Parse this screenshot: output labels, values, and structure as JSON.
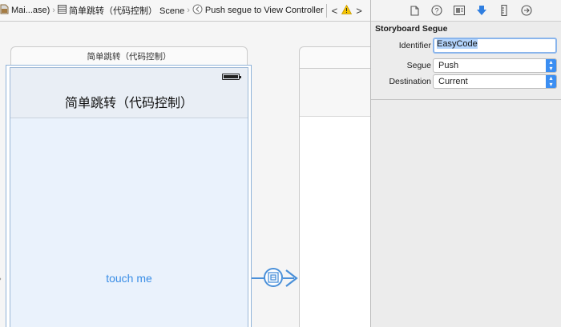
{
  "jumpbar": {
    "item1": "Mai...ase)",
    "item2": "简单跳转（代码控制） Scene",
    "item3": "Push segue to View Controller",
    "back_glyph": "<",
    "forward_glyph": ">"
  },
  "scene1": {
    "title": "简单跳转（代码控制）",
    "nav_title": "简单跳转（代码控制）",
    "button_label": "touch me"
  },
  "inspector": {
    "tabs": [
      "file-icon",
      "help-icon",
      "identity-icon",
      "attributes-icon",
      "size-icon",
      "connections-icon"
    ],
    "section_title": "Storyboard Segue",
    "identifier_label": "Identifier",
    "identifier_value": "EasyCode",
    "segue_label": "Segue",
    "segue_value": "Push",
    "destination_label": "Destination",
    "destination_value": "Current"
  },
  "colors": {
    "accent": "#4a90d9",
    "selected_tab": "#2f7ee0",
    "warning": "#f5c400"
  }
}
